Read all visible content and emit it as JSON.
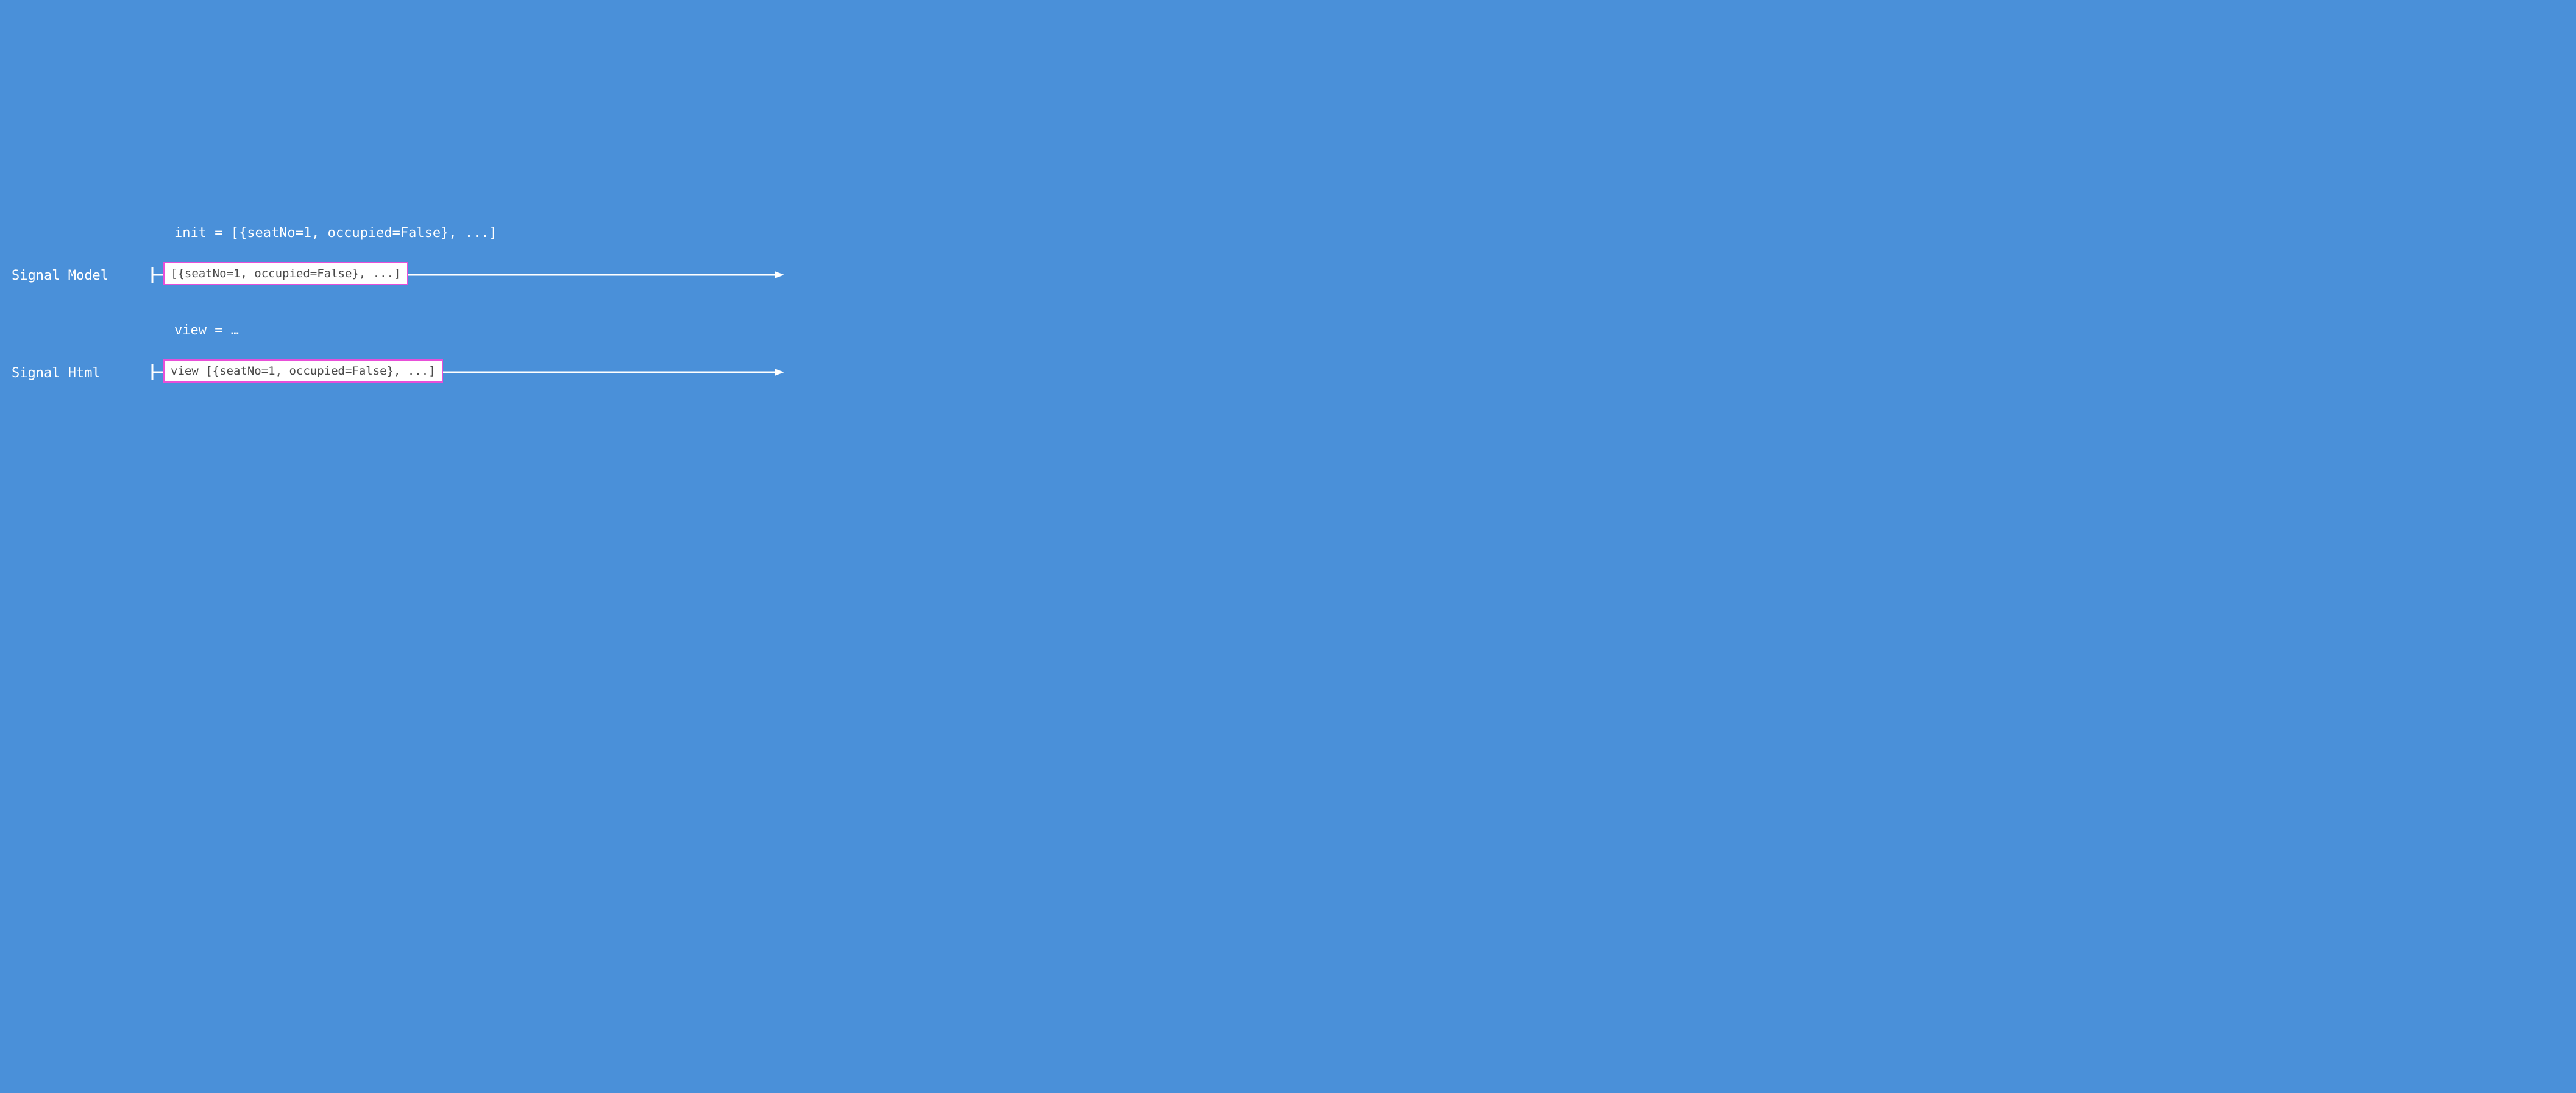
{
  "labels": {
    "init_line": "init = [{seatNo=1, occupied=False}, ...]",
    "view_line": "view = …",
    "signal_model": "Signal Model",
    "signal_html": "Signal Html"
  },
  "boxes": {
    "model_box": "[{seatNo=1, occupied=False}, ...]",
    "html_box": "view [{seatNo=1, occupied=False}, ...]"
  },
  "colors": {
    "background": "#4a90d9",
    "line": "#ffffff",
    "box_border": "#e84fd8",
    "box_bg": "#ffffff",
    "box_text": "#4a4a4a"
  }
}
